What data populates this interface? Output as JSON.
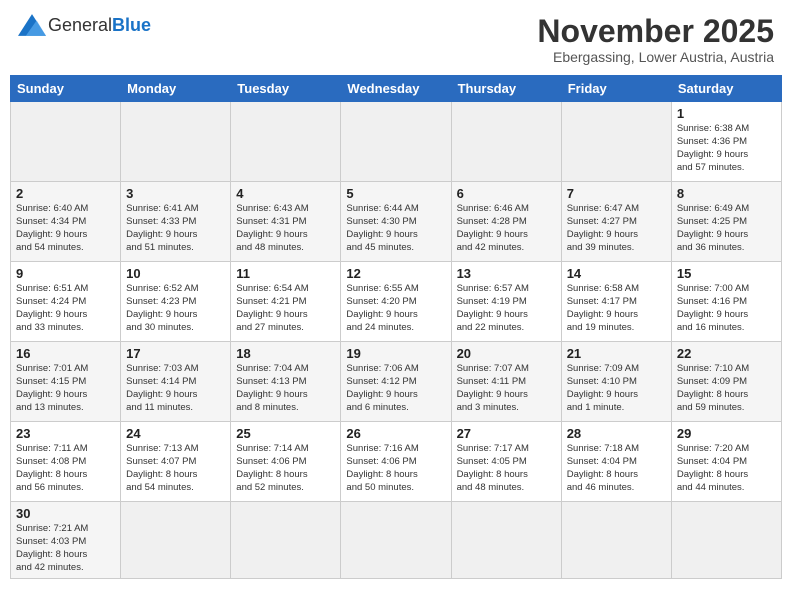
{
  "header": {
    "logo_general": "General",
    "logo_blue": "Blue",
    "title": "November 2025",
    "subtitle": "Ebergassing, Lower Austria, Austria"
  },
  "weekdays": [
    "Sunday",
    "Monday",
    "Tuesday",
    "Wednesday",
    "Thursday",
    "Friday",
    "Saturday"
  ],
  "weeks": [
    [
      {
        "day": "",
        "info": ""
      },
      {
        "day": "",
        "info": ""
      },
      {
        "day": "",
        "info": ""
      },
      {
        "day": "",
        "info": ""
      },
      {
        "day": "",
        "info": ""
      },
      {
        "day": "",
        "info": ""
      },
      {
        "day": "1",
        "info": "Sunrise: 6:38 AM\nSunset: 4:36 PM\nDaylight: 9 hours\nand 57 minutes."
      }
    ],
    [
      {
        "day": "2",
        "info": "Sunrise: 6:40 AM\nSunset: 4:34 PM\nDaylight: 9 hours\nand 54 minutes."
      },
      {
        "day": "3",
        "info": "Sunrise: 6:41 AM\nSunset: 4:33 PM\nDaylight: 9 hours\nand 51 minutes."
      },
      {
        "day": "4",
        "info": "Sunrise: 6:43 AM\nSunset: 4:31 PM\nDaylight: 9 hours\nand 48 minutes."
      },
      {
        "day": "5",
        "info": "Sunrise: 6:44 AM\nSunset: 4:30 PM\nDaylight: 9 hours\nand 45 minutes."
      },
      {
        "day": "6",
        "info": "Sunrise: 6:46 AM\nSunset: 4:28 PM\nDaylight: 9 hours\nand 42 minutes."
      },
      {
        "day": "7",
        "info": "Sunrise: 6:47 AM\nSunset: 4:27 PM\nDaylight: 9 hours\nand 39 minutes."
      },
      {
        "day": "8",
        "info": "Sunrise: 6:49 AM\nSunset: 4:25 PM\nDaylight: 9 hours\nand 36 minutes."
      }
    ],
    [
      {
        "day": "9",
        "info": "Sunrise: 6:51 AM\nSunset: 4:24 PM\nDaylight: 9 hours\nand 33 minutes."
      },
      {
        "day": "10",
        "info": "Sunrise: 6:52 AM\nSunset: 4:23 PM\nDaylight: 9 hours\nand 30 minutes."
      },
      {
        "day": "11",
        "info": "Sunrise: 6:54 AM\nSunset: 4:21 PM\nDaylight: 9 hours\nand 27 minutes."
      },
      {
        "day": "12",
        "info": "Sunrise: 6:55 AM\nSunset: 4:20 PM\nDaylight: 9 hours\nand 24 minutes."
      },
      {
        "day": "13",
        "info": "Sunrise: 6:57 AM\nSunset: 4:19 PM\nDaylight: 9 hours\nand 22 minutes."
      },
      {
        "day": "14",
        "info": "Sunrise: 6:58 AM\nSunset: 4:17 PM\nDaylight: 9 hours\nand 19 minutes."
      },
      {
        "day": "15",
        "info": "Sunrise: 7:00 AM\nSunset: 4:16 PM\nDaylight: 9 hours\nand 16 minutes."
      }
    ],
    [
      {
        "day": "16",
        "info": "Sunrise: 7:01 AM\nSunset: 4:15 PM\nDaylight: 9 hours\nand 13 minutes."
      },
      {
        "day": "17",
        "info": "Sunrise: 7:03 AM\nSunset: 4:14 PM\nDaylight: 9 hours\nand 11 minutes."
      },
      {
        "day": "18",
        "info": "Sunrise: 7:04 AM\nSunset: 4:13 PM\nDaylight: 9 hours\nand 8 minutes."
      },
      {
        "day": "19",
        "info": "Sunrise: 7:06 AM\nSunset: 4:12 PM\nDaylight: 9 hours\nand 6 minutes."
      },
      {
        "day": "20",
        "info": "Sunrise: 7:07 AM\nSunset: 4:11 PM\nDaylight: 9 hours\nand 3 minutes."
      },
      {
        "day": "21",
        "info": "Sunrise: 7:09 AM\nSunset: 4:10 PM\nDaylight: 9 hours\nand 1 minute."
      },
      {
        "day": "22",
        "info": "Sunrise: 7:10 AM\nSunset: 4:09 PM\nDaylight: 8 hours\nand 59 minutes."
      }
    ],
    [
      {
        "day": "23",
        "info": "Sunrise: 7:11 AM\nSunset: 4:08 PM\nDaylight: 8 hours\nand 56 minutes."
      },
      {
        "day": "24",
        "info": "Sunrise: 7:13 AM\nSunset: 4:07 PM\nDaylight: 8 hours\nand 54 minutes."
      },
      {
        "day": "25",
        "info": "Sunrise: 7:14 AM\nSunset: 4:06 PM\nDaylight: 8 hours\nand 52 minutes."
      },
      {
        "day": "26",
        "info": "Sunrise: 7:16 AM\nSunset: 4:06 PM\nDaylight: 8 hours\nand 50 minutes."
      },
      {
        "day": "27",
        "info": "Sunrise: 7:17 AM\nSunset: 4:05 PM\nDaylight: 8 hours\nand 48 minutes."
      },
      {
        "day": "28",
        "info": "Sunrise: 7:18 AM\nSunset: 4:04 PM\nDaylight: 8 hours\nand 46 minutes."
      },
      {
        "day": "29",
        "info": "Sunrise: 7:20 AM\nSunset: 4:04 PM\nDaylight: 8 hours\nand 44 minutes."
      }
    ],
    [
      {
        "day": "30",
        "info": "Sunrise: 7:21 AM\nSunset: 4:03 PM\nDaylight: 8 hours\nand 42 minutes."
      },
      {
        "day": "",
        "info": ""
      },
      {
        "day": "",
        "info": ""
      },
      {
        "day": "",
        "info": ""
      },
      {
        "day": "",
        "info": ""
      },
      {
        "day": "",
        "info": ""
      },
      {
        "day": "",
        "info": ""
      }
    ]
  ]
}
